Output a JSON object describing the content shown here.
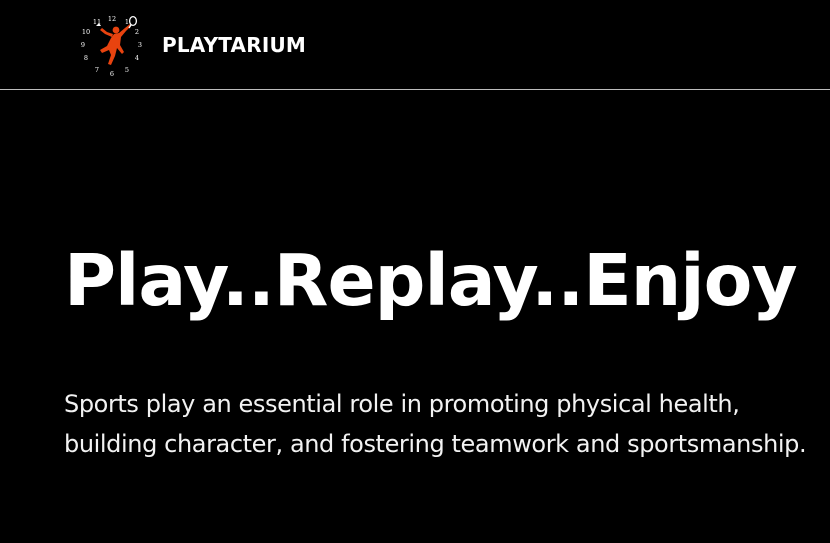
{
  "header": {
    "logo": {
      "icon": "badminton-clock-icon",
      "accent_color": "#e8430f",
      "clock_numbers": [
        "12",
        "1",
        "2",
        "3",
        "4",
        "5",
        "6",
        "7",
        "8",
        "9",
        "10",
        "11"
      ]
    },
    "brand_name": "PLAYTARIUM"
  },
  "hero": {
    "title": "Play..Replay..Enjoy",
    "description": "Sports play an essential role in promoting physical health, building character, and fostering teamwork and sportsmanship."
  }
}
